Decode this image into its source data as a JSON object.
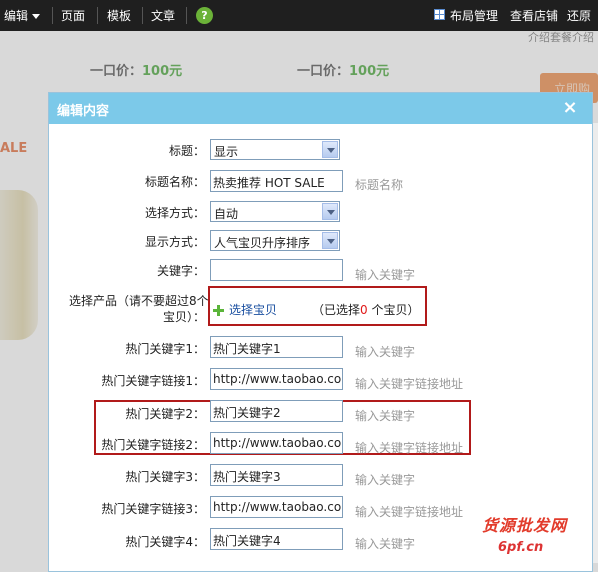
{
  "toolbar": {
    "edit_label": "编辑",
    "page_label": "页面",
    "template_label": "模板",
    "article_label": "文章",
    "help_label": "?",
    "layout_label": "布局管理",
    "view_shop_label": "查看店铺",
    "restore_label": "还原"
  },
  "background": {
    "price1": {
      "label": "一口价：",
      "value": "100元"
    },
    "price2": {
      "label": "一口价：",
      "value": "100元"
    },
    "sale_text": "ALE",
    "top_right_text": "介绍套餐介绍",
    "buy_button": "立即购"
  },
  "dialog": {
    "title": "编辑内容",
    "close_label": "×",
    "fields": {
      "title_label": "标题：",
      "title_value": "显示",
      "title_name_label": "标题名称：",
      "title_name_value": "热卖推荐 HOT SALE",
      "title_name_hint": "标题名称",
      "select_mode_label": "选择方式：",
      "select_mode_value": "自动",
      "display_mode_label": "显示方式：",
      "display_mode_value": "人气宝贝升序排序",
      "keyword_label": "关键字：",
      "keyword_value": "",
      "keyword_hint": "输入关键字",
      "select_product_label_1": "选择产品（请不要超过8个",
      "select_product_label_2": "宝贝）：",
      "select_product_link": "选择宝贝",
      "selected_prefix": "（已选择",
      "selected_count": "0",
      "selected_suffix": " 个宝贝）",
      "hot_kw1_label": "热门关键字1：",
      "hot_kw1_value": "热门关键字1",
      "hot_kw1_hint": "输入关键字",
      "hot_link1_label": "热门关键字链接1：",
      "hot_link1_value": "http://www.taobao.com",
      "hot_link1_hint": "输入关键字链接地址",
      "hot_kw2_label": "热门关键字2：",
      "hot_kw2_value": "热门关键字2",
      "hot_kw2_hint": "输入关键字",
      "hot_link2_label": "热门关键字链接2：",
      "hot_link2_value": "http://www.taobao.com",
      "hot_link2_hint": "输入关键字链接地址",
      "hot_kw3_label": "热门关键字3：",
      "hot_kw3_value": "热门关键字3",
      "hot_kw3_hint": "输入关键字",
      "hot_link3_label": "热门关键字链接3：",
      "hot_link3_value": "http://www.taobao.com",
      "hot_link3_hint": "输入关键字链接地址",
      "hot_kw4_label": "热门关键字4：",
      "hot_kw4_value": "热门关键字4",
      "hot_kw4_hint": "输入关键字"
    }
  },
  "watermark": {
    "line1": "货源批发网",
    "line2": "6pf.cn"
  },
  "colors": {
    "header": "#7cc9e9",
    "highlight_box": "#b11a1a",
    "price_green": "#2a9a1a",
    "toolbar_bg": "#1f1f1f"
  }
}
